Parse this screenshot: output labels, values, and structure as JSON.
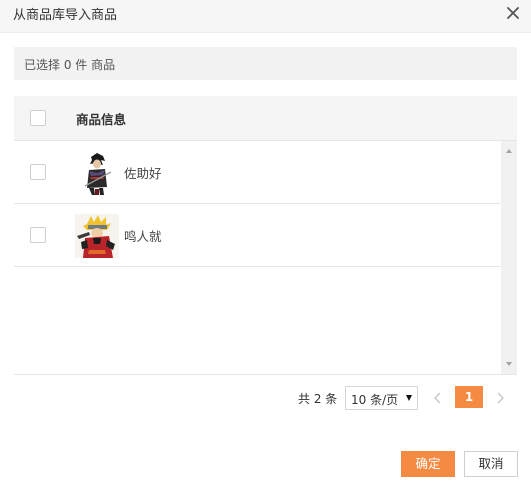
{
  "dialog": {
    "title": "从商品库导入商品"
  },
  "summary": {
    "text": "已选择 0 件 商品"
  },
  "table": {
    "header_label": "商品信息",
    "rows": [
      {
        "name": "佐助好",
        "thumbnail": "ninja-character-thumbnail"
      },
      {
        "name": "鸣人就",
        "thumbnail": "ninja-character-thumbnail"
      }
    ]
  },
  "pagination": {
    "total_text": "共 2 条",
    "page_size": "10 条/页",
    "current_page": "1"
  },
  "buttons": {
    "ok": "确定",
    "cancel": "取消"
  },
  "colors": {
    "accent": "#f58a43",
    "header_bg": "#f5f5f5",
    "summary_bg": "#f2f2f2"
  }
}
